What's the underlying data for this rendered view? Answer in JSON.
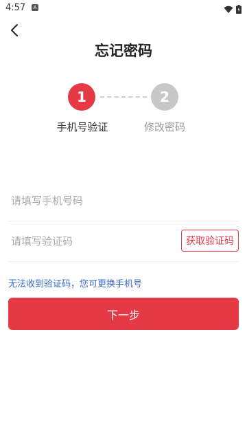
{
  "status_bar": {
    "time": "4:57",
    "notification_icon": "a-icon",
    "icons": [
      "wifi-icon",
      "battery-icon"
    ]
  },
  "header": {
    "back_icon": "chevron-left-icon",
    "title": "忘记密码"
  },
  "steps": [
    {
      "number": "1",
      "label": "手机号验证",
      "active": true
    },
    {
      "number": "2",
      "label": "修改密码",
      "active": false
    }
  ],
  "form": {
    "phone_placeholder": "请填写手机号码",
    "phone_value": "",
    "code_placeholder": "请填写验证码",
    "code_value": "",
    "get_code_label": "获取验证码"
  },
  "help_link": "无法收到验证码，您可更换手机号",
  "next_button": "下一步",
  "colors": {
    "accent": "#e63946",
    "inactive_step": "#c8c8c8",
    "link": "#3b6cc7"
  }
}
